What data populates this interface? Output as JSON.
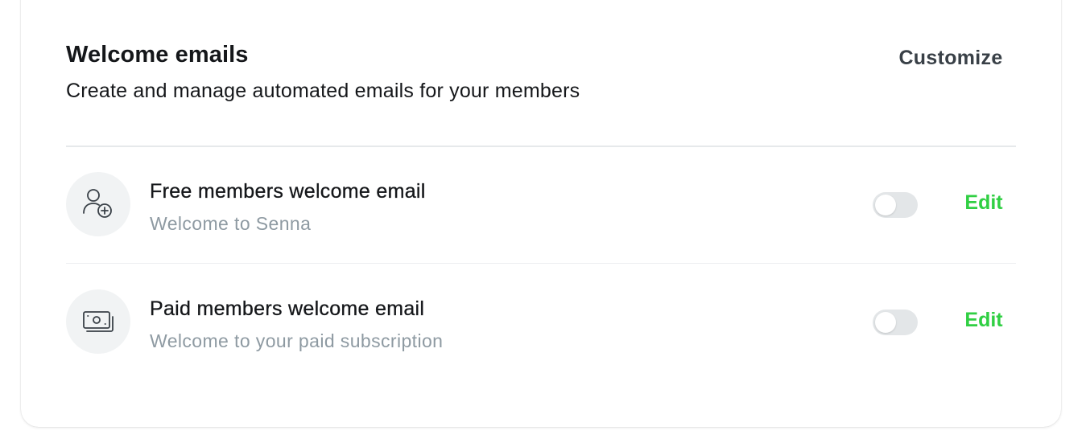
{
  "section": {
    "title": "Welcome emails",
    "subtitle": "Create and manage automated emails for your members",
    "customize_label": "Customize"
  },
  "emails": [
    {
      "title": "Free members welcome email",
      "subtitle": "Welcome to Senna",
      "icon": "user-add-icon",
      "enabled": false,
      "edit_label": "Edit"
    },
    {
      "title": "Paid members welcome email",
      "subtitle": "Welcome to your paid subscription",
      "icon": "money-icon",
      "enabled": false,
      "edit_label": "Edit"
    }
  ],
  "colors": {
    "accent": "#30cf43",
    "muted_text": "#8e9aa2",
    "toggle_off": "#e3e6e8",
    "icon_bg": "#f1f3f4"
  }
}
